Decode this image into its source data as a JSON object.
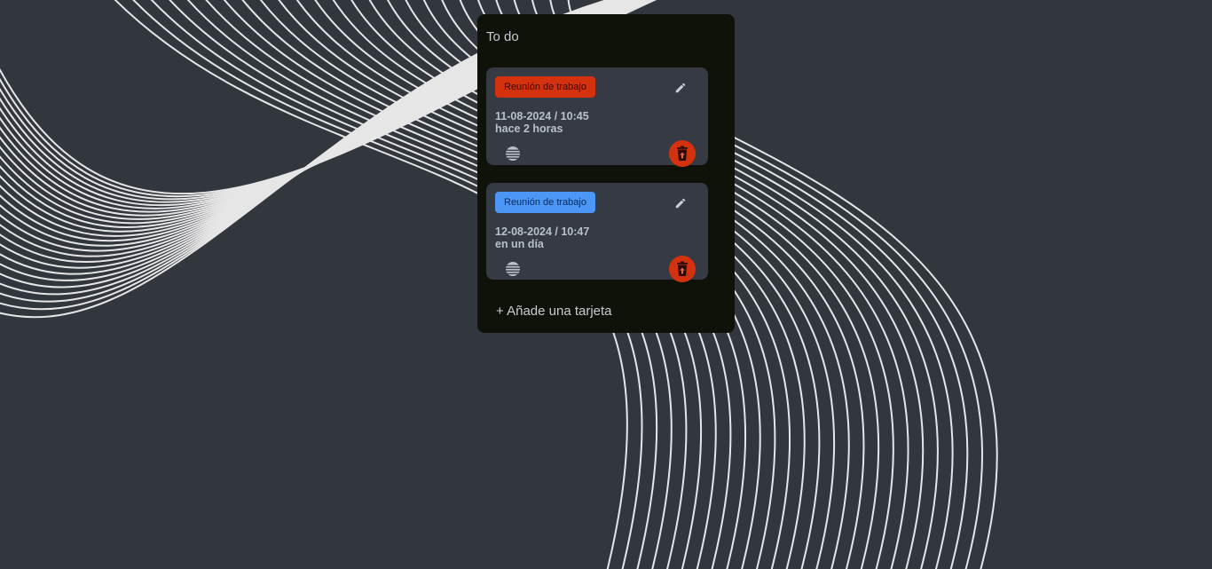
{
  "list": {
    "title": "To do",
    "add_card_label": "+ Añade una tarjeta",
    "cards": [
      {
        "label": "Reunión de trabajo",
        "label_color": "#d4320f",
        "date": "11-08-2024 / 10:45",
        "relative": "hace 2 horas",
        "icons": [
          "edit-pencil-icon",
          "description-icon",
          "trash-icon"
        ]
      },
      {
        "label": "Reunión de trabajo",
        "label_color": "#4c96f5",
        "date": "12-08-2024 / 10:47",
        "relative": "en un día",
        "icons": [
          "edit-pencil-icon",
          "description-icon",
          "trash-icon"
        ]
      }
    ]
  },
  "colors": {
    "background": "#32363d",
    "list_background": "#0f1208",
    "card_background": "#353a43",
    "delete_button": "#d4320f",
    "wave_lines": "#e6e6e6"
  }
}
